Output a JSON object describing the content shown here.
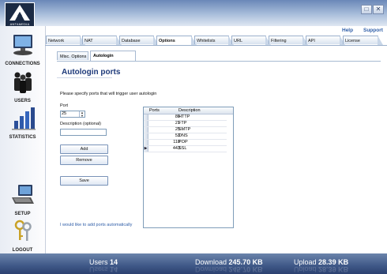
{
  "app": {
    "logo_text": "ANTAMEDIA"
  },
  "window": {
    "minimize_glyph": "□",
    "close_glyph": "✕"
  },
  "header_links": {
    "help": "Help",
    "support": "Support"
  },
  "sidebar": {
    "items": [
      {
        "label": "CONNECTIONS",
        "icon": "monitor-icon"
      },
      {
        "label": "USERS",
        "icon": "people-icon"
      },
      {
        "label": "STATISTICS",
        "icon": "bar-chart-icon"
      },
      {
        "label": "SETUP",
        "icon": "setup-computer-icon"
      },
      {
        "label": "LOGOUT",
        "icon": "keys-icon"
      }
    ]
  },
  "tabs": [
    "Network",
    "NAT",
    "Database",
    "Options",
    "Whitelists",
    "URL",
    "Filtering",
    "API",
    "License"
  ],
  "active_tab": "Options",
  "subtabs": [
    "Misc. Options",
    "Autologin"
  ],
  "active_subtab": "Autologin",
  "page": {
    "title": "Autologin ports",
    "description": "Please specify ports that will trigger user autologin",
    "port_label": "Port",
    "port_value": "25",
    "desc_label": "Description (optional)",
    "desc_value": "",
    "add_button": "Add",
    "remove_button": "Remove",
    "save_button": "Save",
    "auto_link": "I would like to add ports automatically"
  },
  "grid": {
    "columns": [
      "Ports",
      "Description"
    ],
    "rows": [
      {
        "port": "80",
        "description": "HTTP"
      },
      {
        "port": "21",
        "description": "FTP"
      },
      {
        "port": "25",
        "description": "SMTP"
      },
      {
        "port": "53",
        "description": "DNS"
      },
      {
        "port": "110",
        "description": "POP"
      },
      {
        "port": "443",
        "description": "SSL"
      }
    ],
    "selected_row_marker": "▶"
  },
  "status": {
    "users_label": "Users",
    "users_value": "14",
    "download_label": "Download",
    "download_value": "245.70 KB",
    "upload_label": "Upload",
    "upload_value": "28.39 KB"
  }
}
